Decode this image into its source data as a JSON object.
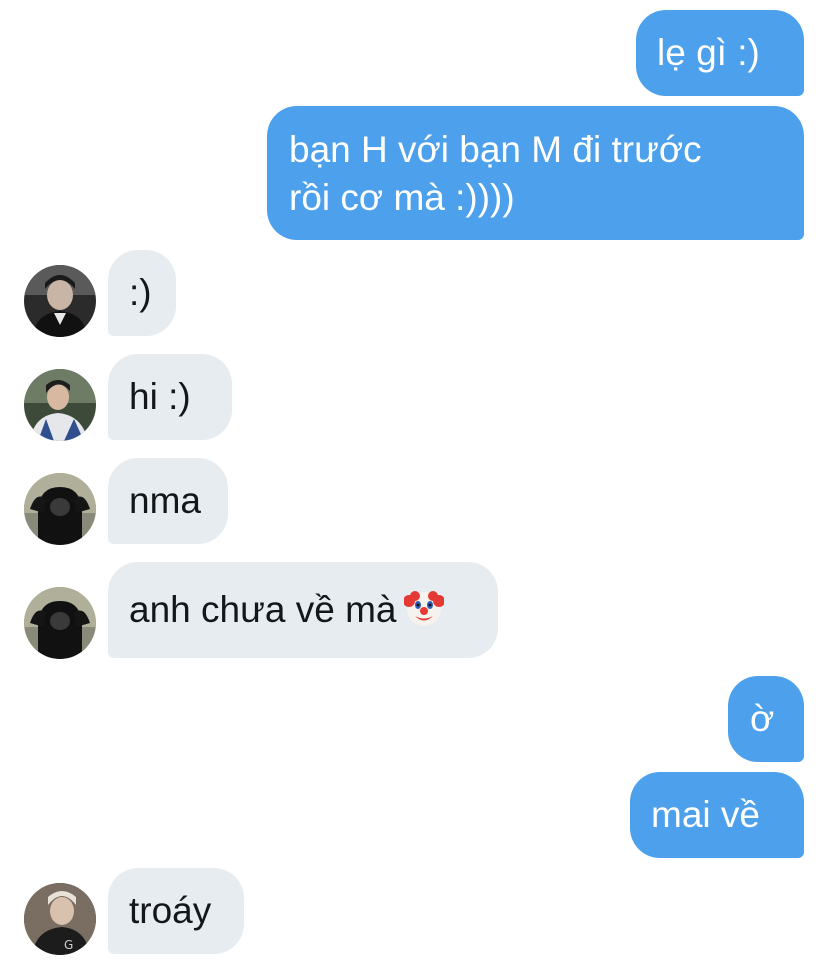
{
  "messages": [
    {
      "side": "out",
      "text": "lẹ gì :)"
    },
    {
      "side": "out",
      "text": "bạn H với bạn M đi trước\nrồi cơ mà :))))"
    },
    {
      "side": "in",
      "text": ":)",
      "avatar": "user-avatar-1"
    },
    {
      "side": "in",
      "text": "hi :)",
      "avatar": "user-avatar-2"
    },
    {
      "side": "in",
      "text": "nma",
      "avatar": "user-avatar-3"
    },
    {
      "side": "in",
      "text": "anh chưa về mà",
      "emoji": "clown-face-icon",
      "avatar": "user-avatar-3"
    },
    {
      "side": "out",
      "text": "ờ"
    },
    {
      "side": "out",
      "text": "mai về"
    },
    {
      "side": "in",
      "text": "troáy",
      "avatar": "user-avatar-4"
    }
  ],
  "colors": {
    "outgoing_bubble": "#4da0eb",
    "incoming_bubble": "#e6ecf0",
    "incoming_text": "#14171a",
    "outgoing_text": "#ffffff"
  }
}
